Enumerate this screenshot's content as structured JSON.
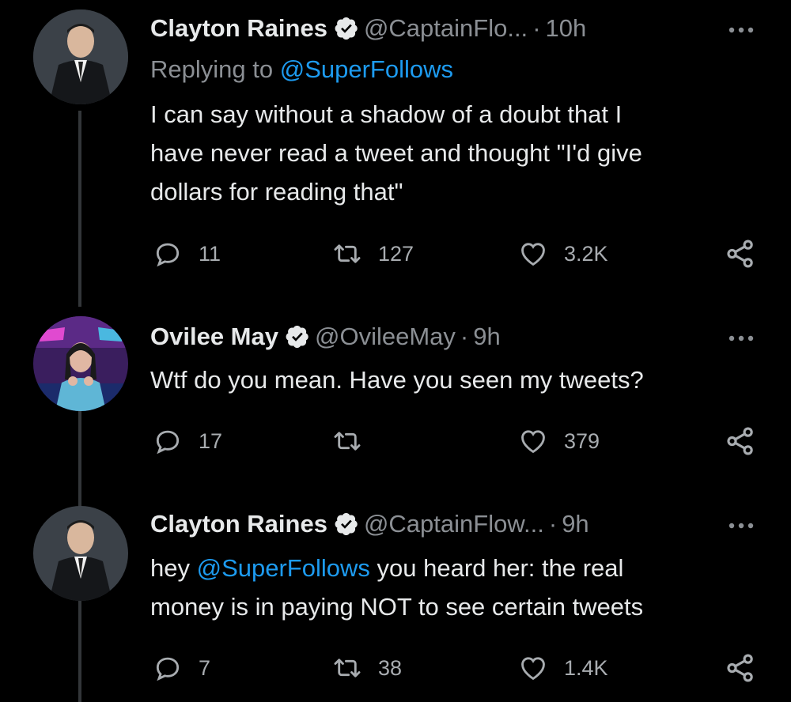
{
  "tweets": [
    {
      "name": "Clayton Raines",
      "handle": "@CaptainFlo...",
      "time": "10h",
      "replying_prefix": "Replying to ",
      "replying_to": "@SuperFollows",
      "lines": [
        "I can say without a shadow of a doubt that I",
        "have never read a tweet and thought \"I'd give",
        "dollars for reading that\""
      ],
      "replies": "11",
      "retweets": "127",
      "likes": "3.2K"
    },
    {
      "name": "Ovilee May",
      "handle": "@OvileeMay",
      "time": "9h",
      "lines": [
        "Wtf do you mean. Have you seen my tweets?"
      ],
      "replies": "17",
      "retweets": "",
      "likes": "379"
    },
    {
      "name": "Clayton Raines",
      "handle": "@CaptainFlow...",
      "time": "9h",
      "line1_prefix": "hey ",
      "line1_mention": "@SuperFollows",
      "line1_suffix": " you heard her: the real",
      "line2": "money is in paying NOT to see certain tweets",
      "replies": "7",
      "retweets": "38",
      "likes": "1.4K"
    }
  ],
  "icons": {
    "verified": "verified-badge-icon",
    "reply": "reply-bubble-icon",
    "retweet": "retweet-arrows-icon",
    "like": "heart-icon",
    "share": "share-nodes-icon",
    "more": "more-dots-icon"
  },
  "colors": {
    "background": "#000000",
    "text": "#e7e9ea",
    "muted": "#8b8f94",
    "link": "#1d9bf0",
    "thread_line": "#333639"
  }
}
